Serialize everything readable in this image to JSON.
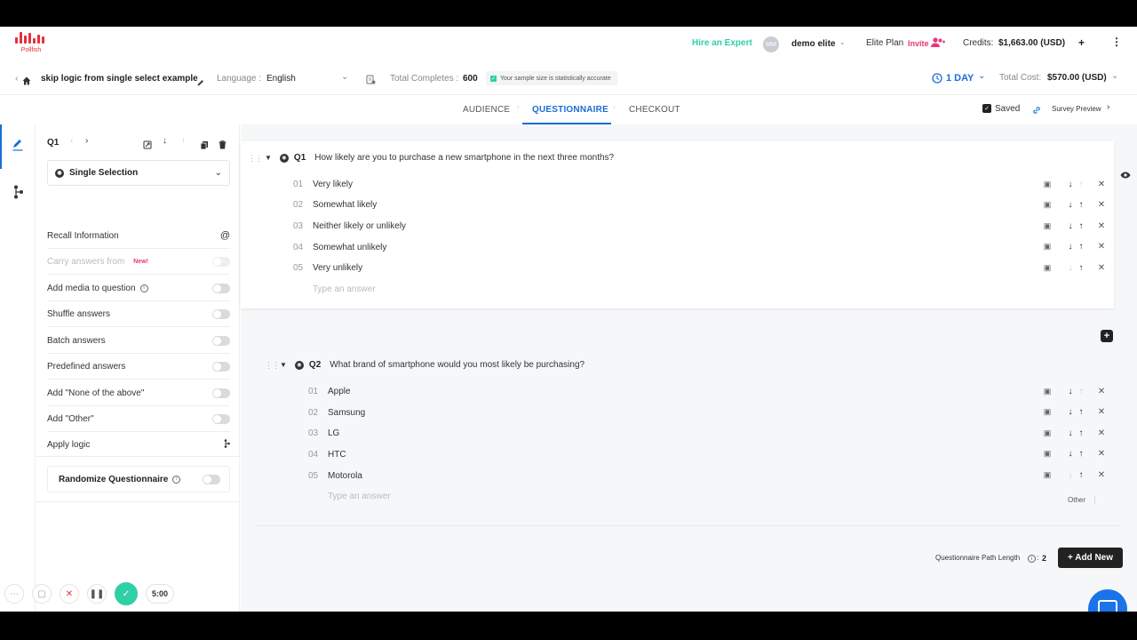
{
  "brand": {
    "name": "Pollfish",
    "color": "#e5303a"
  },
  "header": {
    "hire_expert": "Hire an Expert",
    "avatar_initials": "MM",
    "user_name": "demo elite",
    "plan": "Elite Plan",
    "invite": "Invite",
    "credits_label": "Credits:",
    "credits_value": "$1,663.00 (USD)",
    "add": "+",
    "more": "⋮"
  },
  "toolbar": {
    "survey_title": "skip logic from single select example",
    "language_label": "Language :",
    "language_value": "English",
    "completes_label": "Total Completes :",
    "completes_value": "600",
    "sample_note": "Your sample size is statistically accurate",
    "duration": "1 DAY",
    "total_cost_label": "Total Cost:",
    "total_cost_value": "$570.00 (USD)"
  },
  "tabs": [
    {
      "label": "AUDIENCE"
    },
    {
      "label": "QUESTIONNAIRE"
    },
    {
      "label": "CHECKOUT"
    }
  ],
  "status": {
    "saved": "Saved",
    "preview": "Survey Preview"
  },
  "panel": {
    "question_id": "Q1",
    "question_type": "Single Selection",
    "options": [
      {
        "label": "Recall Information",
        "control": "@"
      },
      {
        "label": "Carry answers from",
        "badge": "New!"
      },
      {
        "label": "Add media to question"
      },
      {
        "label": "Shuffle answers"
      },
      {
        "label": "Batch answers"
      },
      {
        "label": "Predefined answers"
      },
      {
        "label": "Add \"None of the above\""
      },
      {
        "label": "Add \"Other\""
      },
      {
        "label": "Apply logic"
      }
    ],
    "randomize": "Randomize Questionnaire"
  },
  "questions": [
    {
      "id": "Q1",
      "text": "How likely are you to purchase a new smartphone in the next three months?",
      "answers": [
        {
          "num": "01",
          "text": "Very likely"
        },
        {
          "num": "02",
          "text": "Somewhat likely"
        },
        {
          "num": "03",
          "text": "Neither likely or unlikely"
        },
        {
          "num": "04",
          "text": "Somewhat unlikely"
        },
        {
          "num": "05",
          "text": "Very unlikely"
        }
      ],
      "placeholder": "Type an answer"
    },
    {
      "id": "Q2",
      "text": "What brand of smartphone would you most likely be purchasing?",
      "answers": [
        {
          "num": "01",
          "text": "Apple"
        },
        {
          "num": "02",
          "text": "Samsung"
        },
        {
          "num": "03",
          "text": "LG"
        },
        {
          "num": "04",
          "text": "HTC"
        },
        {
          "num": "05",
          "text": "Motorola"
        }
      ],
      "placeholder": "Type an answer",
      "other": "Other"
    }
  ],
  "footer": {
    "path_length_label": "Questionnaire Path Length",
    "path_length_value": "2",
    "add_new": "+ Add New"
  },
  "recorder": {
    "timer": "5:00"
  }
}
